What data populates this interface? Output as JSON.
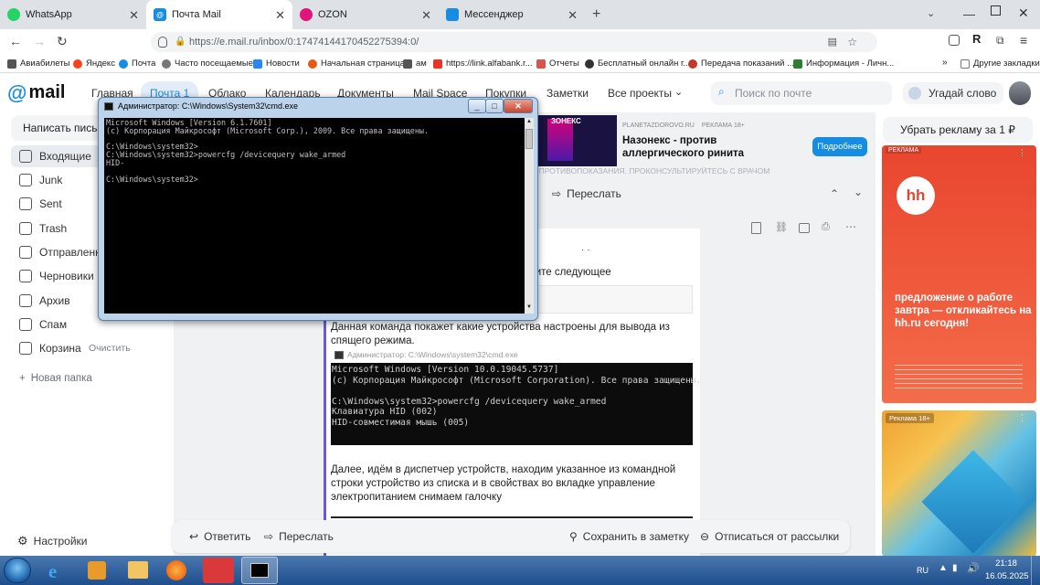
{
  "tabs": [
    {
      "label": "WhatsApp",
      "color": "#25d366",
      "active": false
    },
    {
      "label": "Почта Mail",
      "color": "#168de2",
      "active": true
    },
    {
      "label": "OZON",
      "color": "#e0147a",
      "active": false
    },
    {
      "label": "Мессенджер",
      "color": "#168de2",
      "active": false
    }
  ],
  "browser": {
    "url": "https://e.mail.ru/inbox/0:17474144170452275394:0/"
  },
  "bookmarks": [
    {
      "label": "Авиабилеты",
      "color": "#555"
    },
    {
      "label": "Яндекс",
      "color": "#fc3f1d"
    },
    {
      "label": "Почта",
      "color": "#168de2"
    },
    {
      "label": "Часто посещаемые",
      "color": "#777"
    },
    {
      "label": "Новости",
      "color": "#2787f5"
    },
    {
      "label": "Начальная страница",
      "color": "#e55b13"
    },
    {
      "label": "ам",
      "color": "#555"
    },
    {
      "label": "https://link.alfabank.r...",
      "color": "#ef3124"
    },
    {
      "label": "Отчеты",
      "color": "#d9534f"
    },
    {
      "label": "Бесплатный онлайн г...",
      "color": "#333"
    },
    {
      "label": "Передача показаний ...",
      "color": "#c0392b"
    },
    {
      "label": "Информация - Личн...",
      "color": "#2e7d32"
    },
    {
      "label": "Другие закладки",
      "color": "#777"
    }
  ],
  "mail": {
    "logo_text": "mail",
    "nav": [
      "Главная",
      "Почта 1",
      "Облако",
      "Календарь",
      "Документы",
      "Mail Space",
      "Покупки",
      "Заметки",
      "Все проекты"
    ],
    "search_placeholder": "Поиск по почте",
    "guess_word": "Угадай слово",
    "compose": "Написать письмо",
    "folders": [
      {
        "label": "Входящие",
        "active": true
      },
      {
        "label": "Junk"
      },
      {
        "label": "Sent"
      },
      {
        "label": "Trash"
      },
      {
        "label": "Отправленные"
      },
      {
        "label": "Черновики"
      },
      {
        "label": "Архив"
      },
      {
        "label": "Спам"
      },
      {
        "label": "Корзина",
        "action": "Очистить"
      }
    ],
    "new_folder": "Новая папка",
    "settings": "Настройки",
    "forward": "Переслать",
    "reply": "Ответить",
    "save_note": "Сохранить в заметку",
    "unsubscribe": "Отписаться от рассылки"
  },
  "ad": {
    "source": "PLANETAZDOROVO.RU",
    "label": "РЕКЛАМА 18+",
    "title": "Назонекс - против аллергического ринита",
    "button": "Подробнее",
    "image_text": "ЗОНЕКС",
    "warning_strip": "ЕСТЬ ПРОТИВОПОКАЗАНИЯ. ПРОКОНСУЛЬТИРУЙТЕСЬ С ВРАЧОМ"
  },
  "right_panel": {
    "remove_ads": "Убрать рекламу за 1 ₽",
    "hh_label": "РЕКЛАМА",
    "hh_logo": "hh",
    "hh_text": "предложение о работе завтра — откликайтесь на hh.ru сегодня!",
    "ad2_label": "Реклама 18+"
  },
  "letter": {
    "frag1": "жите следующее",
    "p1": "Данная команда покажет какие устройства настроены для вывода из спящего режима.",
    "p2": "Далее, идём в диспетчер устройств, находим указанное из командной строки устройство из списка и в свойствах во вкладке управление электропитанием снимаем галочку"
  },
  "cmd": {
    "title": "Администратор: C:\\Windows\\System32\\cmd.exe",
    "lines": [
      "Microsoft Windows [Version 6.1.7601]",
      "(c) Корпорация Майкрософт (Microsoft Corp.), 2009. Все права защищены.",
      "",
      "C:\\Windows\\system32>",
      "C:\\Windows\\system32>powercfg /devicequery wake_armed",
      "HID-",
      "",
      "C:\\Windows\\system32>"
    ]
  },
  "shot": {
    "title": "Администратор: C:\\Windows\\system32\\cmd.exe",
    "lines": [
      "Microsoft Windows [Version 10.0.19045.5737]",
      "(c) Корпорация Майкрософт (Microsoft Corporation). Все права защищены.",
      "",
      "C:\\Windows\\system32>powercfg /devicequery wake_armed",
      "Клавиатура HID (002)",
      "HID-совместимая мышь (005)"
    ]
  },
  "taskbar": {
    "lang": "RU",
    "time": "21:18",
    "date": "16.05.2025"
  }
}
